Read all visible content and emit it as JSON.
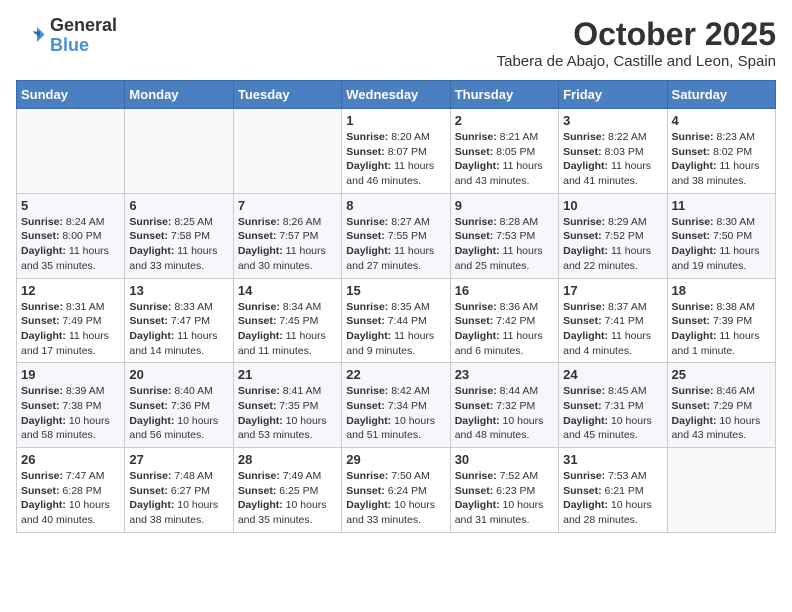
{
  "logo": {
    "general": "General",
    "blue": "Blue"
  },
  "title": "October 2025",
  "subtitle": "Tabera de Abajo, Castille and Leon, Spain",
  "days_of_week": [
    "Sunday",
    "Monday",
    "Tuesday",
    "Wednesday",
    "Thursday",
    "Friday",
    "Saturday"
  ],
  "weeks": [
    [
      {
        "day": "",
        "info": ""
      },
      {
        "day": "",
        "info": ""
      },
      {
        "day": "",
        "info": ""
      },
      {
        "day": "1",
        "info": "Sunrise: 8:20 AM\nSunset: 8:07 PM\nDaylight: 11 hours and 46 minutes."
      },
      {
        "day": "2",
        "info": "Sunrise: 8:21 AM\nSunset: 8:05 PM\nDaylight: 11 hours and 43 minutes."
      },
      {
        "day": "3",
        "info": "Sunrise: 8:22 AM\nSunset: 8:03 PM\nDaylight: 11 hours and 41 minutes."
      },
      {
        "day": "4",
        "info": "Sunrise: 8:23 AM\nSunset: 8:02 PM\nDaylight: 11 hours and 38 minutes."
      }
    ],
    [
      {
        "day": "5",
        "info": "Sunrise: 8:24 AM\nSunset: 8:00 PM\nDaylight: 11 hours and 35 minutes."
      },
      {
        "day": "6",
        "info": "Sunrise: 8:25 AM\nSunset: 7:58 PM\nDaylight: 11 hours and 33 minutes."
      },
      {
        "day": "7",
        "info": "Sunrise: 8:26 AM\nSunset: 7:57 PM\nDaylight: 11 hours and 30 minutes."
      },
      {
        "day": "8",
        "info": "Sunrise: 8:27 AM\nSunset: 7:55 PM\nDaylight: 11 hours and 27 minutes."
      },
      {
        "day": "9",
        "info": "Sunrise: 8:28 AM\nSunset: 7:53 PM\nDaylight: 11 hours and 25 minutes."
      },
      {
        "day": "10",
        "info": "Sunrise: 8:29 AM\nSunset: 7:52 PM\nDaylight: 11 hours and 22 minutes."
      },
      {
        "day": "11",
        "info": "Sunrise: 8:30 AM\nSunset: 7:50 PM\nDaylight: 11 hours and 19 minutes."
      }
    ],
    [
      {
        "day": "12",
        "info": "Sunrise: 8:31 AM\nSunset: 7:49 PM\nDaylight: 11 hours and 17 minutes."
      },
      {
        "day": "13",
        "info": "Sunrise: 8:33 AM\nSunset: 7:47 PM\nDaylight: 11 hours and 14 minutes."
      },
      {
        "day": "14",
        "info": "Sunrise: 8:34 AM\nSunset: 7:45 PM\nDaylight: 11 hours and 11 minutes."
      },
      {
        "day": "15",
        "info": "Sunrise: 8:35 AM\nSunset: 7:44 PM\nDaylight: 11 hours and 9 minutes."
      },
      {
        "day": "16",
        "info": "Sunrise: 8:36 AM\nSunset: 7:42 PM\nDaylight: 11 hours and 6 minutes."
      },
      {
        "day": "17",
        "info": "Sunrise: 8:37 AM\nSunset: 7:41 PM\nDaylight: 11 hours and 4 minutes."
      },
      {
        "day": "18",
        "info": "Sunrise: 8:38 AM\nSunset: 7:39 PM\nDaylight: 11 hours and 1 minute."
      }
    ],
    [
      {
        "day": "19",
        "info": "Sunrise: 8:39 AM\nSunset: 7:38 PM\nDaylight: 10 hours and 58 minutes."
      },
      {
        "day": "20",
        "info": "Sunrise: 8:40 AM\nSunset: 7:36 PM\nDaylight: 10 hours and 56 minutes."
      },
      {
        "day": "21",
        "info": "Sunrise: 8:41 AM\nSunset: 7:35 PM\nDaylight: 10 hours and 53 minutes."
      },
      {
        "day": "22",
        "info": "Sunrise: 8:42 AM\nSunset: 7:34 PM\nDaylight: 10 hours and 51 minutes."
      },
      {
        "day": "23",
        "info": "Sunrise: 8:44 AM\nSunset: 7:32 PM\nDaylight: 10 hours and 48 minutes."
      },
      {
        "day": "24",
        "info": "Sunrise: 8:45 AM\nSunset: 7:31 PM\nDaylight: 10 hours and 45 minutes."
      },
      {
        "day": "25",
        "info": "Sunrise: 8:46 AM\nSunset: 7:29 PM\nDaylight: 10 hours and 43 minutes."
      }
    ],
    [
      {
        "day": "26",
        "info": "Sunrise: 7:47 AM\nSunset: 6:28 PM\nDaylight: 10 hours and 40 minutes."
      },
      {
        "day": "27",
        "info": "Sunrise: 7:48 AM\nSunset: 6:27 PM\nDaylight: 10 hours and 38 minutes."
      },
      {
        "day": "28",
        "info": "Sunrise: 7:49 AM\nSunset: 6:25 PM\nDaylight: 10 hours and 35 minutes."
      },
      {
        "day": "29",
        "info": "Sunrise: 7:50 AM\nSunset: 6:24 PM\nDaylight: 10 hours and 33 minutes."
      },
      {
        "day": "30",
        "info": "Sunrise: 7:52 AM\nSunset: 6:23 PM\nDaylight: 10 hours and 31 minutes."
      },
      {
        "day": "31",
        "info": "Sunrise: 7:53 AM\nSunset: 6:21 PM\nDaylight: 10 hours and 28 minutes."
      },
      {
        "day": "",
        "info": ""
      }
    ]
  ],
  "colors": {
    "header_bg": "#4a7fc1",
    "header_text": "#ffffff",
    "even_row_bg": "#f5f7fa",
    "odd_row_bg": "#ffffff"
  }
}
